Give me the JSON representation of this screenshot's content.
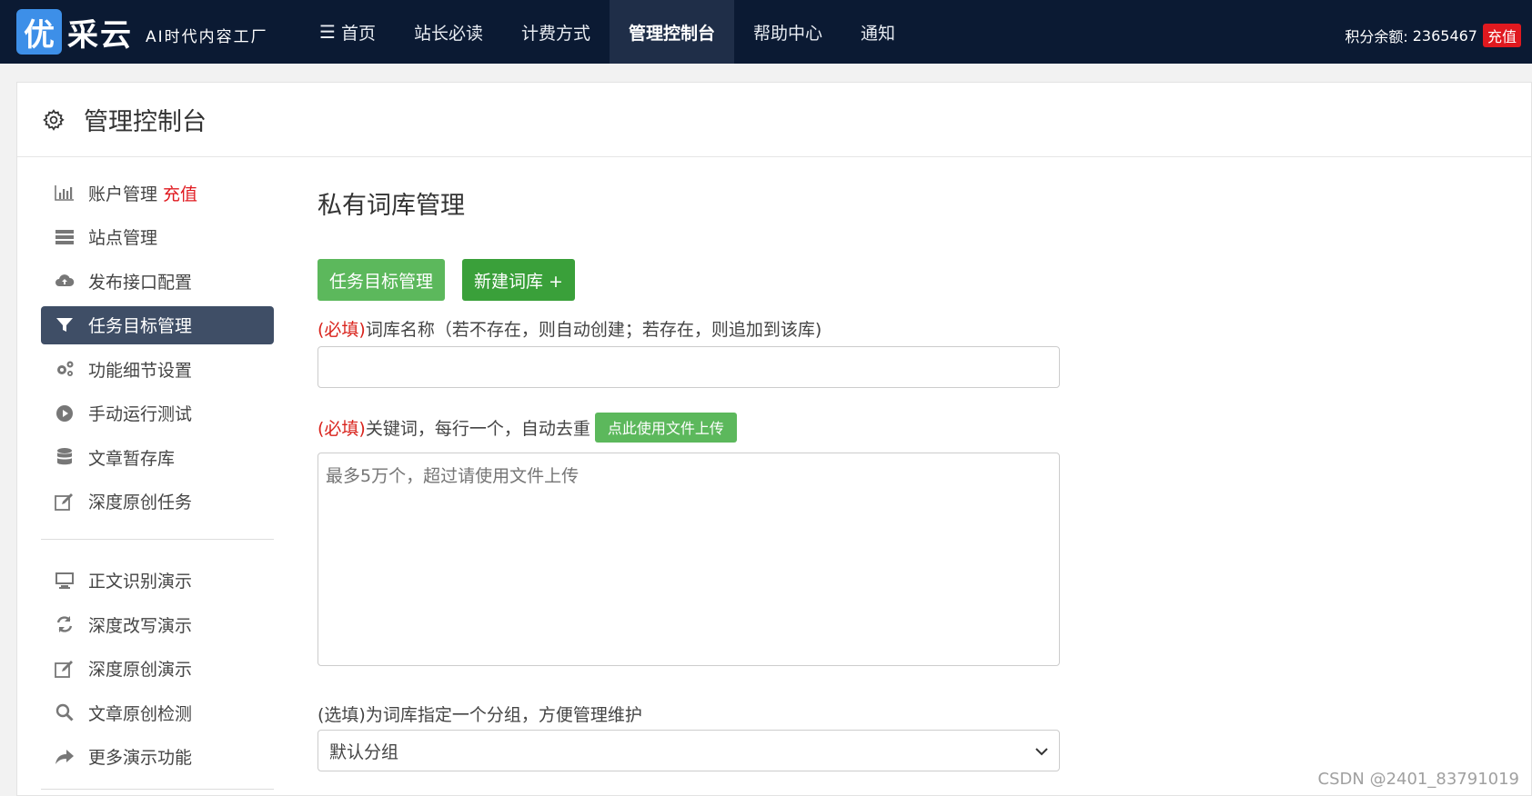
{
  "brand": {
    "logo_char": "优",
    "name": "采云",
    "slogan": "AI时代内容工厂"
  },
  "nav": {
    "items": [
      {
        "label": "首页",
        "icon": "list-icon"
      },
      {
        "label": "站长必读"
      },
      {
        "label": "计费方式"
      },
      {
        "label": "管理控制台",
        "active": true
      },
      {
        "label": "帮助中心"
      },
      {
        "label": "通知"
      }
    ]
  },
  "account": {
    "points_label": "积分余额:",
    "points_value": "2365467",
    "recharge_label": "充值"
  },
  "panel": {
    "title": "管理控制台"
  },
  "sidebar": {
    "items": [
      {
        "label": "账户管理",
        "extra": "充值",
        "icon": "bar-chart-icon"
      },
      {
        "label": "站点管理",
        "icon": "server-icon"
      },
      {
        "label": "发布接口配置",
        "icon": "cloud-upload-icon"
      },
      {
        "label": "任务目标管理",
        "icon": "filter-icon",
        "active": true
      },
      {
        "label": "功能细节设置",
        "icon": "gears-icon"
      },
      {
        "label": "手动运行测试",
        "icon": "play-circle-icon"
      },
      {
        "label": "文章暂存库",
        "icon": "database-icon"
      },
      {
        "label": "深度原创任务",
        "icon": "edit-icon"
      }
    ],
    "demo_items": [
      {
        "label": "正文识别演示",
        "icon": "monitor-icon"
      },
      {
        "label": "深度改写演示",
        "icon": "refresh-icon"
      },
      {
        "label": "深度原创演示",
        "icon": "edit-icon"
      },
      {
        "label": "文章原创检测",
        "icon": "search-icon"
      },
      {
        "label": "更多演示功能",
        "icon": "share-icon"
      }
    ]
  },
  "main": {
    "title": "私有词库管理",
    "btn_task": "任务目标管理",
    "btn_new": "新建词库 +",
    "field1": {
      "required": "(必填)",
      "label": "词库名称（若不存在，则自动创建；若存在，则追加到该库)",
      "value": ""
    },
    "field2": {
      "required": "(必填)",
      "label": "关键词，每行一个，自动去重",
      "upload_label": "点此使用文件上传",
      "placeholder": "最多5万个，超过请使用文件上传"
    },
    "field3": {
      "label": "(选填)为词库指定一个分组，方便管理维护",
      "selected": "默认分组"
    }
  },
  "watermark": "CSDN @2401_83791019",
  "colors": {
    "nav_bg": "#0b1a33",
    "active_side": "#3f4e66",
    "green": "#5cb85c",
    "green_dark": "#3aa03a",
    "required_red": "#d9231c"
  }
}
